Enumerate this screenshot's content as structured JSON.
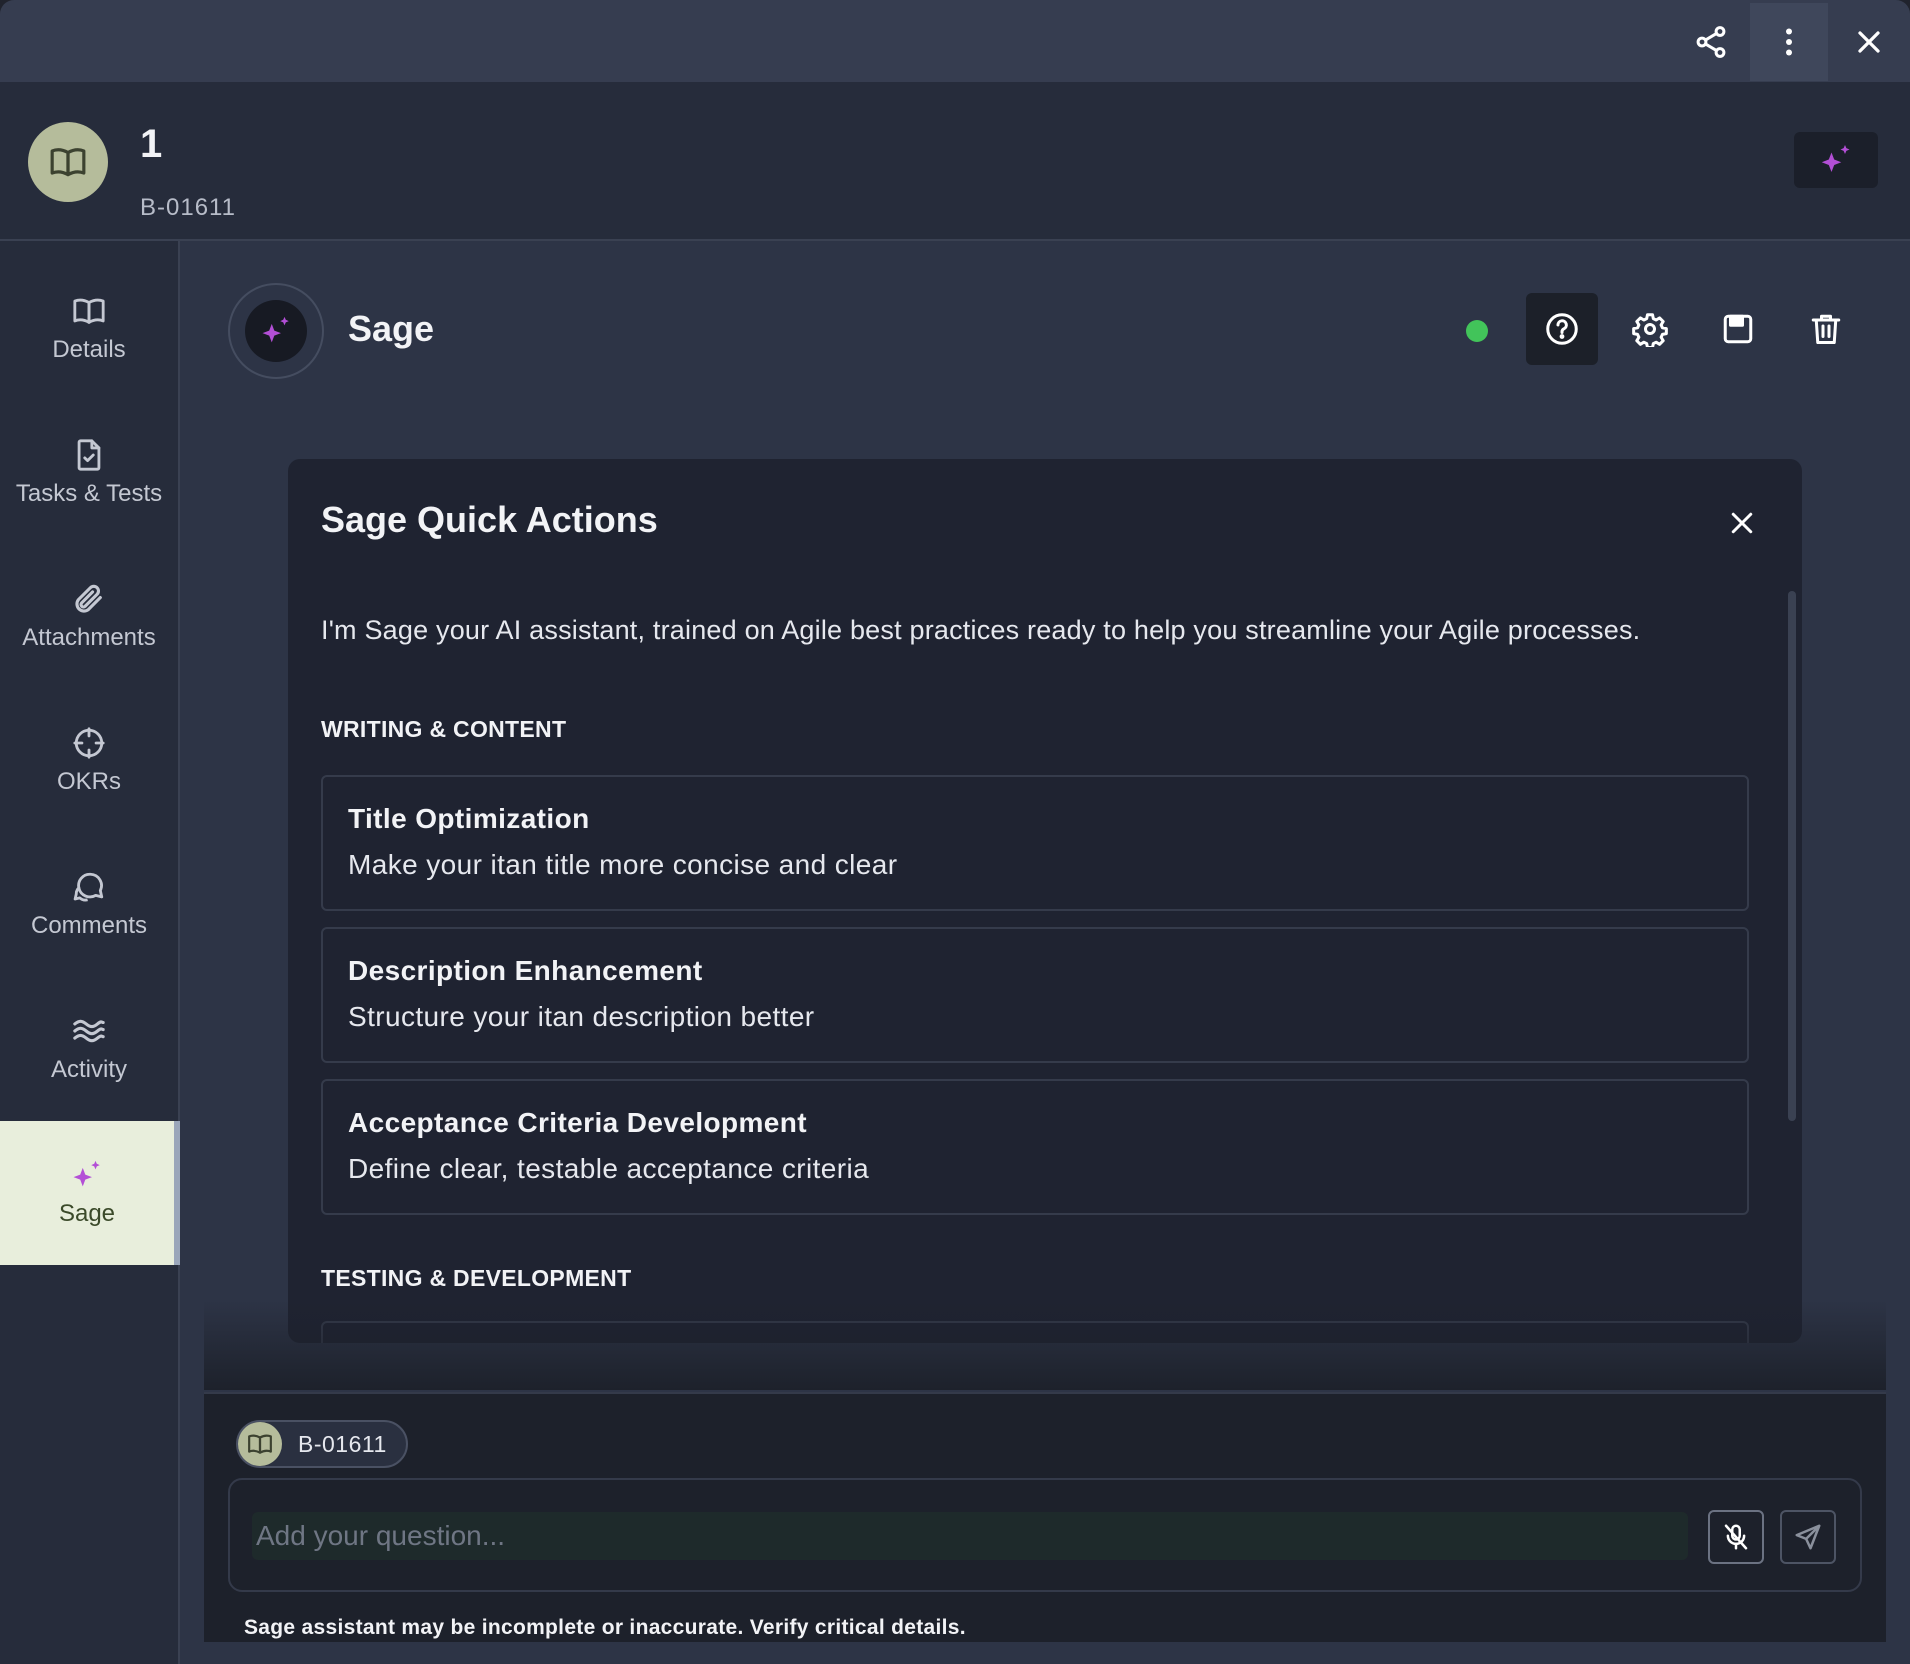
{
  "topbar": {
    "share_icon": "share-icon",
    "more_icon": "more-vertical-icon",
    "close_icon": "close-icon"
  },
  "item": {
    "title": "1",
    "id": "B-01611",
    "icon": "book-icon"
  },
  "sidenav": {
    "items": [
      {
        "label": "Details",
        "icon": "book-icon"
      },
      {
        "label": "Tasks & Tests",
        "icon": "file-check-icon"
      },
      {
        "label": "Attachments",
        "icon": "paperclip-icon"
      },
      {
        "label": "OKRs",
        "icon": "target-icon"
      },
      {
        "label": "Comments",
        "icon": "comments-icon"
      },
      {
        "label": "Activity",
        "icon": "activity-icon"
      },
      {
        "label": "Sage",
        "icon": "sparkle-icon",
        "active": true
      }
    ]
  },
  "sage": {
    "name": "Sage",
    "status": "online",
    "status_color": "#42c45a",
    "tools": [
      "help-icon",
      "settings-icon",
      "save-icon",
      "trash-icon"
    ]
  },
  "quick_actions": {
    "title": "Sage Quick Actions",
    "intro": "I'm Sage your AI assistant, trained on Agile best practices ready to help you streamline your Agile processes.",
    "sections": [
      {
        "title": "WRITING & CONTENT",
        "actions": [
          {
            "title": "Title Optimization",
            "description": "Make your itan title more concise and clear"
          },
          {
            "title": "Description Enhancement",
            "description": "Structure your itan description better"
          },
          {
            "title": "Acceptance Criteria Development",
            "description": "Define clear, testable acceptance criteria"
          }
        ]
      },
      {
        "title": "TESTING & DEVELOPMENT",
        "actions": []
      }
    ]
  },
  "composer": {
    "context_chip": "B-01611",
    "placeholder": "Add your question...",
    "value": "",
    "disclaimer": "Sage assistant may be incomplete or inaccurate. Verify critical details."
  },
  "colors": {
    "accent_sparkle": "#b34fd6",
    "avatar_bg": "#b5bc9b",
    "active_nav_bg": "#e8eedc"
  }
}
